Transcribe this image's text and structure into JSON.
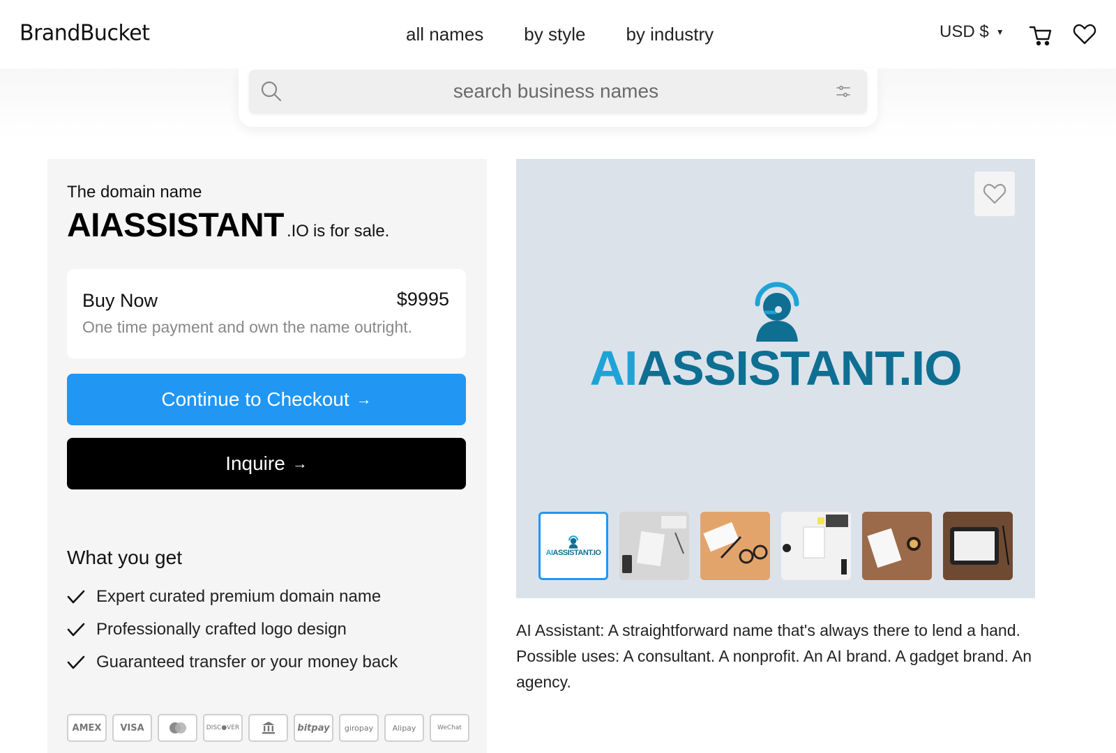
{
  "header": {
    "logo": "BrandBucket",
    "nav": [
      "all names",
      "by style",
      "by industry"
    ],
    "currency": "USD $"
  },
  "search": {
    "placeholder": "search business names"
  },
  "listing": {
    "intro": "The domain name",
    "domain_name": "AIASSISTANT",
    "tld": ".IO",
    "suffix": "is for sale.",
    "buy_now": {
      "title": "Buy Now",
      "price": "$9995",
      "subtitle": "One time payment and own the name outright."
    },
    "checkout_label": "Continue to Checkout",
    "inquire_label": "Inquire",
    "arrow": "→",
    "what_you_get": {
      "title": "What you get",
      "items": [
        "Expert curated premium domain name",
        "Professionally crafted logo design",
        "Guaranteed transfer or your money back"
      ]
    },
    "payment_methods": [
      "AMEX",
      "VISA",
      "",
      "DISC●VER",
      "",
      "bitpay",
      "giropay",
      "Alipay",
      "WeChat"
    ]
  },
  "preview": {
    "logo_text_ai": "AI",
    "logo_text_rest": "ASSISTANT.IO",
    "thumbnail_label_ai": "AI",
    "thumbnail_label_rest": "ASSISTANT.IO",
    "colors": {
      "ai": "#1fa3d6",
      "rest": "#0e6f93",
      "background": "#dce2ea"
    }
  },
  "description": {
    "text": "AI Assistant: A straightforward name that's always there to lend a hand. Possible uses: A consultant. A nonprofit. An AI brand. A gadget brand. An agency."
  },
  "colors": {
    "accent": "#2196f3",
    "inquire": "#000000"
  }
}
